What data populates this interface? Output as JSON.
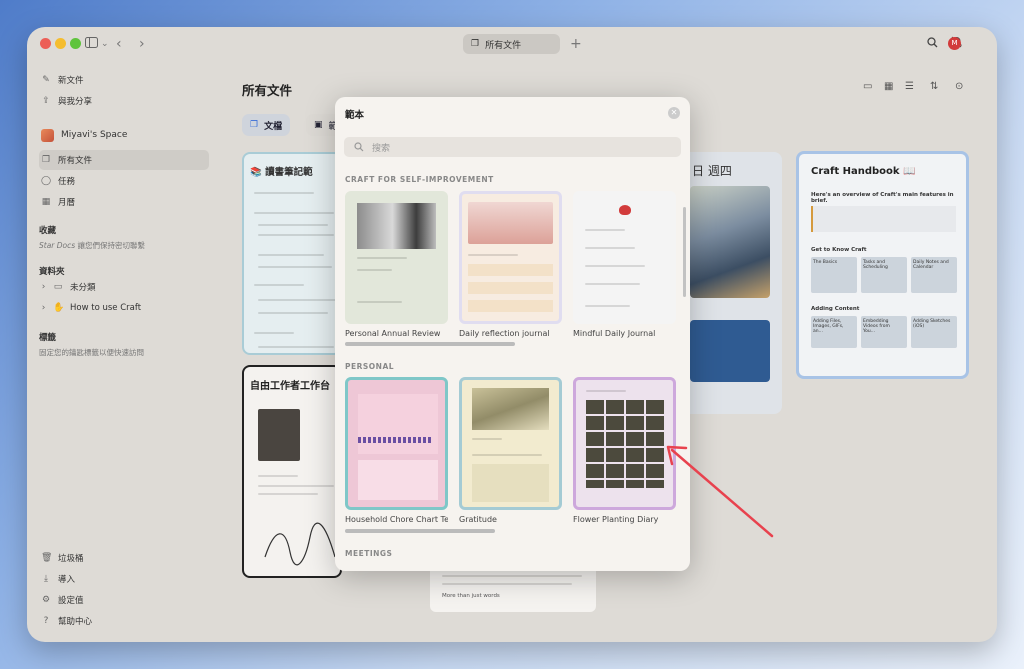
{
  "titlebar": {
    "tab_label": "所有文件",
    "avatar_letter": "M"
  },
  "sidebar": {
    "new_doc": "新文件",
    "shared": "與我分享",
    "space_name": "Miyavi's Space",
    "all_docs": "所有文件",
    "tasks": "任務",
    "calendar": "月曆",
    "favorites_heading": "收藏",
    "favorites_hint_em": "Star Docs",
    "favorites_hint": " 讓您們保持密切聯繫",
    "folders_heading": "資料夾",
    "folder_unsorted": "未分類",
    "folder_howto": "How to use Craft",
    "tags_heading": "標籤",
    "tags_hint": "固定您的鑰匙標籤以便快速訪問",
    "trash": "垃圾桶",
    "import": "導入",
    "settings": "設定值",
    "help": "幫助中心"
  },
  "main": {
    "title": "所有文件",
    "filter_docs": "文檔",
    "filter_second": "範",
    "card_reading_notes": "讀書筆記範",
    "card_freelancer": "自由工作者工作台",
    "card_date": "日 週四",
    "card_handbook_title": "Craft Handbook 📖",
    "card_handbook_intro": "Here's an overview of Craft's main features in brief.",
    "card_handbook_get_to_know": "Get to Know Craft",
    "card_handbook_adding": "Adding Content",
    "card_handbook_tiles": [
      "The Basics",
      "Tasks and Scheduling",
      "Daily Notes and Calendar",
      "Adding Files, Images, GIFs, an...",
      "Embedding Videos from You...",
      "Adding Sketches (iOS)"
    ],
    "bottom_card_text": "More than just words"
  },
  "modal": {
    "title": "範本",
    "search_placeholder": "搜索",
    "section_self_improvement": "CRAFT FOR SELF-IMPROVEMENT",
    "section_personal": "PERSONAL",
    "section_meetings": "MEETINGS",
    "templates_row1": [
      "Personal Annual Review",
      "Daily reflection journal",
      "Mindful Daily Journal"
    ],
    "templates_row2": [
      "Household Chore Chart Te...",
      "Gratitude",
      "Flower Planting Diary"
    ]
  },
  "colors": {
    "arrow": "#e8424e",
    "accent_blue": "#3a6fd8"
  }
}
